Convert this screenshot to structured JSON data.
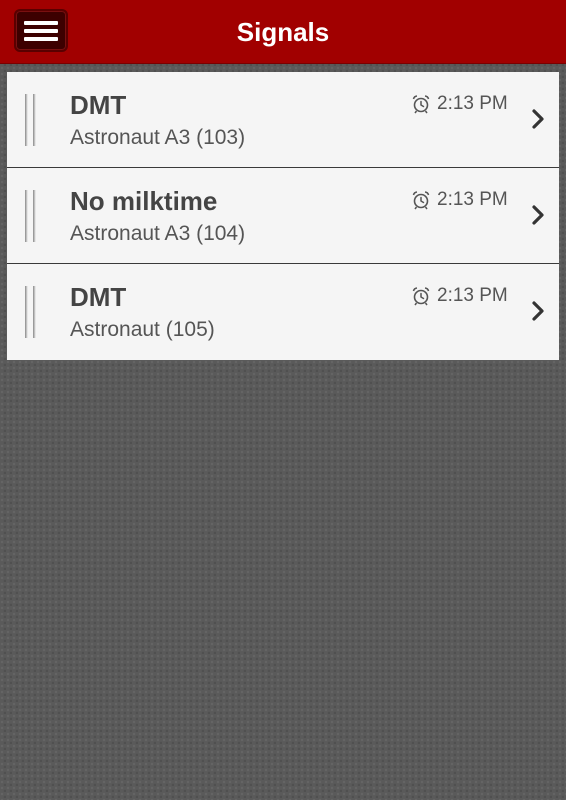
{
  "header": {
    "title": "Signals",
    "menu_icon": "hamburger-menu-icon",
    "bar_color": "#a10000"
  },
  "signals": [
    {
      "title": "DMT",
      "subtitle": "Astronaut A3 (103)",
      "time": "2:13 PM",
      "icon": "alarm-clock-icon"
    },
    {
      "title": "No milktime",
      "subtitle": "Astronaut A3 (104)",
      "time": "2:13 PM",
      "icon": "alarm-clock-icon"
    },
    {
      "title": "DMT",
      "subtitle": "Astronaut (105)",
      "time": "2:13 PM",
      "icon": "alarm-clock-icon"
    }
  ]
}
